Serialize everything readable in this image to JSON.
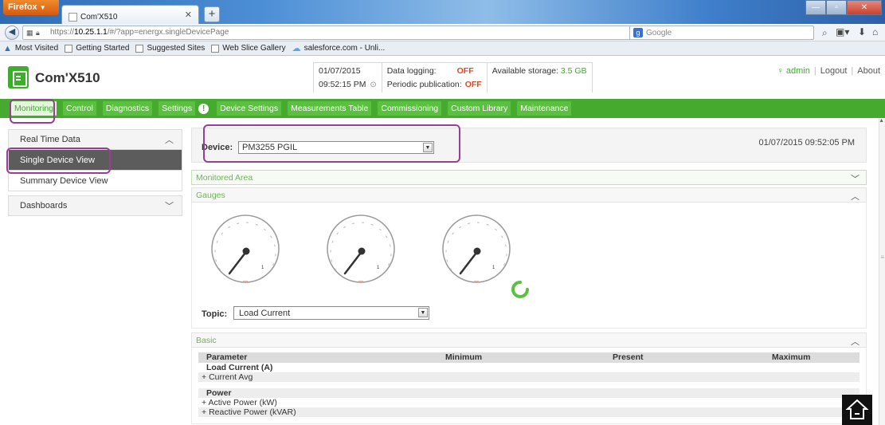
{
  "browser": {
    "firefox_button": "Firefox",
    "tab_title": "Com'X510",
    "url_prefix": "https://",
    "url_host": "10.25.1.1",
    "url_path": "/#/?app=energx.singleDevicePage",
    "search_placeholder": "Google",
    "bookmarks": [
      "Most Visited",
      "Getting Started",
      "Suggested Sites",
      "Web Slice Gallery",
      "salesforce.com - Unli..."
    ]
  },
  "header": {
    "app_title": "Com'X510",
    "date": "01/07/2015",
    "time": "09:52:15 PM",
    "data_logging_label": "Data logging:",
    "data_logging_value": "OFF",
    "periodic_label": "Periodic publication:",
    "periodic_value": "OFF",
    "storage_label": "Available storage:",
    "storage_value": "3.5 GB",
    "user": "admin",
    "logout": "Logout",
    "about": "About"
  },
  "menu": {
    "items": [
      "Monitoring",
      "Control",
      "Diagnostics",
      "Settings",
      "Device Settings",
      "Measurements Table",
      "Commissioning",
      "Custom Library",
      "Maintenance"
    ]
  },
  "sidebar": {
    "real_time_data": "Real Time Data",
    "single_device_view": "Single Device View",
    "summary_device_view": "Summary Device View",
    "dashboards": "Dashboards"
  },
  "main": {
    "device_label": "Device:",
    "device_value": "PM3255 PGIL",
    "timestamp": "01/07/2015 09:52:05 PM",
    "monitored_area": "Monitored Area",
    "gauges_title": "Gauges",
    "gauge_scale_max": "1",
    "gauge_value": "---",
    "topic_label": "Topic:",
    "topic_value": "Load Current",
    "basic_title": "Basic",
    "table_headers": [
      "Parameter",
      "Minimum",
      "Present",
      "Maximum"
    ],
    "groups": [
      {
        "name": "Load Current (A)",
        "rows": [
          "Current Avg"
        ]
      },
      {
        "name": "Power",
        "rows": [
          "Active Power (kW)",
          "Reactive Power (kVAR)"
        ]
      }
    ]
  },
  "colors": {
    "brand_green": "#45aa2d",
    "status_off": "#e0461d",
    "highlight_purple": "#9b3c9a"
  }
}
